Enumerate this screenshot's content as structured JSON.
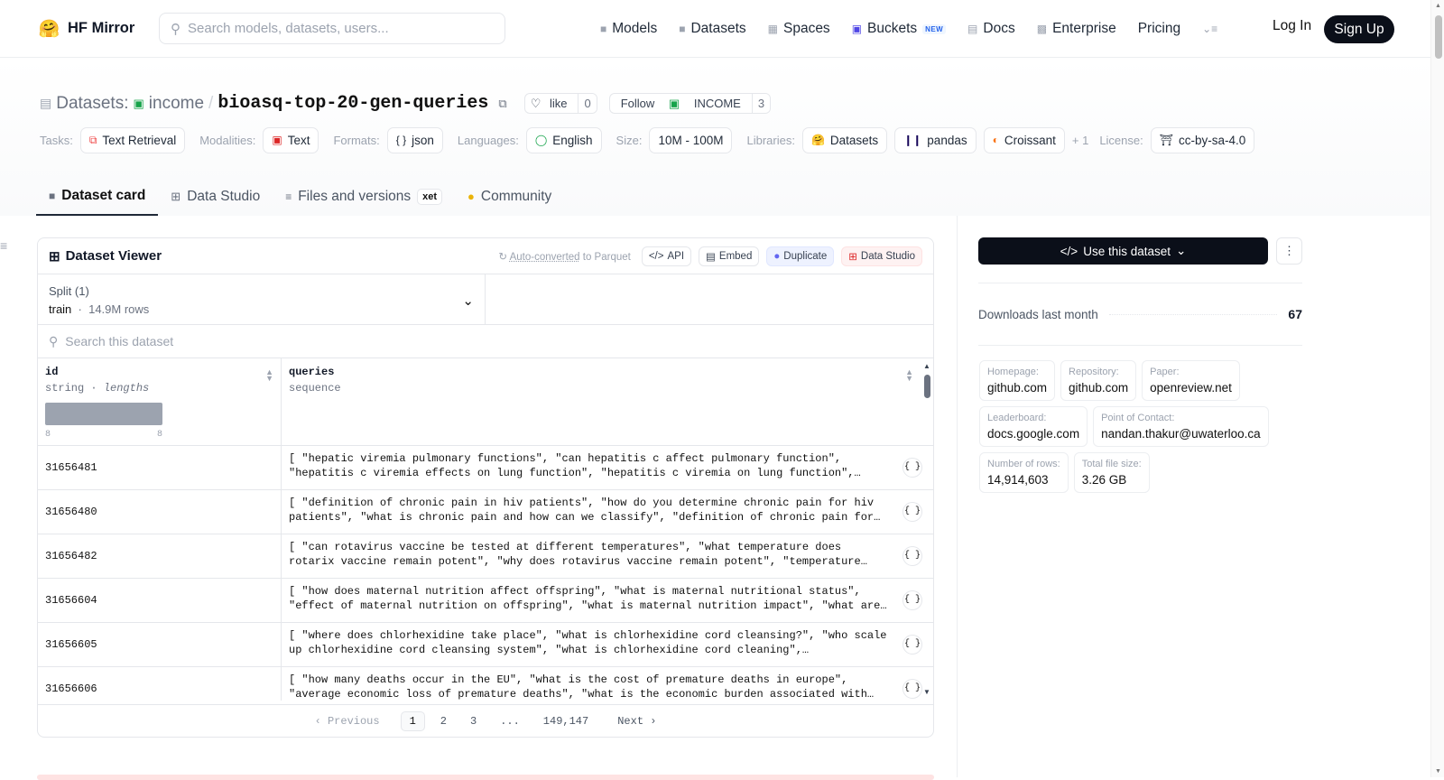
{
  "nav": {
    "logo_text": "HF Mirror",
    "search_placeholder": "Search models, datasets, users...",
    "links": [
      {
        "label": "Models",
        "icon": "cube-icon"
      },
      {
        "label": "Datasets",
        "icon": "database-icon"
      },
      {
        "label": "Spaces",
        "icon": "grid-icon"
      },
      {
        "label": "Buckets",
        "icon": "bucket-icon",
        "badge": "NEW"
      },
      {
        "label": "Docs",
        "icon": "book-icon"
      },
      {
        "label": "Enterprise",
        "icon": "enterprise-icon"
      },
      {
        "label": "Pricing"
      }
    ],
    "login": "Log In",
    "signup": "Sign Up"
  },
  "header": {
    "section": "Datasets:",
    "org": "income",
    "repo": "bioasq-top-20-gen-queries",
    "like_label": "like",
    "like_count": "0",
    "follow_label": "Follow",
    "follow_org": "INCOME",
    "follow_count": "3"
  },
  "tags": {
    "tasks_label": "Tasks:",
    "task": "Text Retrieval",
    "modalities_label": "Modalities:",
    "modality": "Text",
    "formats_label": "Formats:",
    "format": "json",
    "languages_label": "Languages:",
    "language": "English",
    "size_label": "Size:",
    "size": "10M - 100M",
    "libraries_label": "Libraries:",
    "lib1": "Datasets",
    "lib2": "pandas",
    "lib3": "Croissant",
    "lib_more": "+ 1",
    "license_label": "License:",
    "license": "cc-by-sa-4.0"
  },
  "tabs": {
    "card": "Dataset card",
    "studio": "Data Studio",
    "files": "Files and versions",
    "xet": "xet",
    "community": "Community"
  },
  "viewer": {
    "title": "Dataset Viewer",
    "auto_converted_link": "Auto-converted",
    "auto_converted_rest": " to Parquet",
    "api": "API",
    "embed": "Embed",
    "duplicate": "Duplicate",
    "studio": "Data Studio",
    "split_label": "Split (1)",
    "split_name": "train",
    "split_rows": "14.9M rows",
    "search_placeholder": "Search this dataset",
    "col1_name": "id",
    "col1_type": "string",
    "col1_stat": "lengths",
    "col1_min": "8",
    "col1_max": "8",
    "col2_name": "queries",
    "col2_type": "sequence",
    "rows": [
      {
        "id": "31656481",
        "queries": "[ \"hepatic viremia pulmonary functions\", \"can hepatitis c affect pulmonary function\", \"hepatitis c viremia effects on lung function\", \"hepatitis c viremia on lung function\", \"hepatitis c pulmonary effects\" ]"
      },
      {
        "id": "31656480",
        "queries": "[ \"definition of chronic pain in hiv patients\", \"how do you determine chronic pain for hiv patients\", \"what is chronic pain and how can we classify\", \"definition of chronic pain for hiv\" ]"
      },
      {
        "id": "31656482",
        "queries": "[ \"can rotavirus vaccine be tested at different temperatures\", \"what temperature does rotarix vaccine remain potent\", \"why does rotavirus vaccine remain potent\", \"temperature stability of rotavirus vaccine\" ]"
      },
      {
        "id": "31656604",
        "queries": "[ \"how does maternal nutrition affect offspring\", \"what is maternal nutritional status\", \"effect of maternal nutrition on offspring\", \"what is maternal nutrition impact\", \"what are the effects\" ]"
      },
      {
        "id": "31656605",
        "queries": "[ \"where does chlorhexidine take place\", \"what is chlorhexidine cord cleansing?\", \"who scale up chlorhexidine cord cleansing system\", \"what is chlorhexidine cord cleaning\", \"chlorhexidine\" ]"
      },
      {
        "id": "31656606",
        "queries": "[ \"how many deaths occur in the EU\", \"what is the cost of premature deaths in europe\", \"average economic loss of premature deaths\", \"what is the economic burden associated with premature deaths\" ]"
      }
    ],
    "pager": {
      "prev": "Previous",
      "p1": "1",
      "p2": "2",
      "p3": "3",
      "ellipsis": "...",
      "last": "149,147",
      "next": "Next"
    }
  },
  "sidebar": {
    "use_btn": "Use this dataset",
    "downloads_label": "Downloads last month",
    "downloads_value": "67",
    "cards": [
      {
        "label": "Homepage:",
        "value": "github.com"
      },
      {
        "label": "Repository:",
        "value": "github.com"
      },
      {
        "label": "Paper:",
        "value": "openreview.net"
      },
      {
        "label": "Leaderboard:",
        "value": "docs.google.com"
      },
      {
        "label": "Point of Contact:",
        "value": "nandan.thakur@uwaterloo.ca"
      },
      {
        "label": "Number of rows:",
        "value": "14,914,603"
      },
      {
        "label": "Total file size:",
        "value": "3.26 GB"
      }
    ]
  },
  "colors": {
    "primary_dark": "#0b0f19",
    "border": "#e5e7eb",
    "accent_new": "#2563eb"
  }
}
